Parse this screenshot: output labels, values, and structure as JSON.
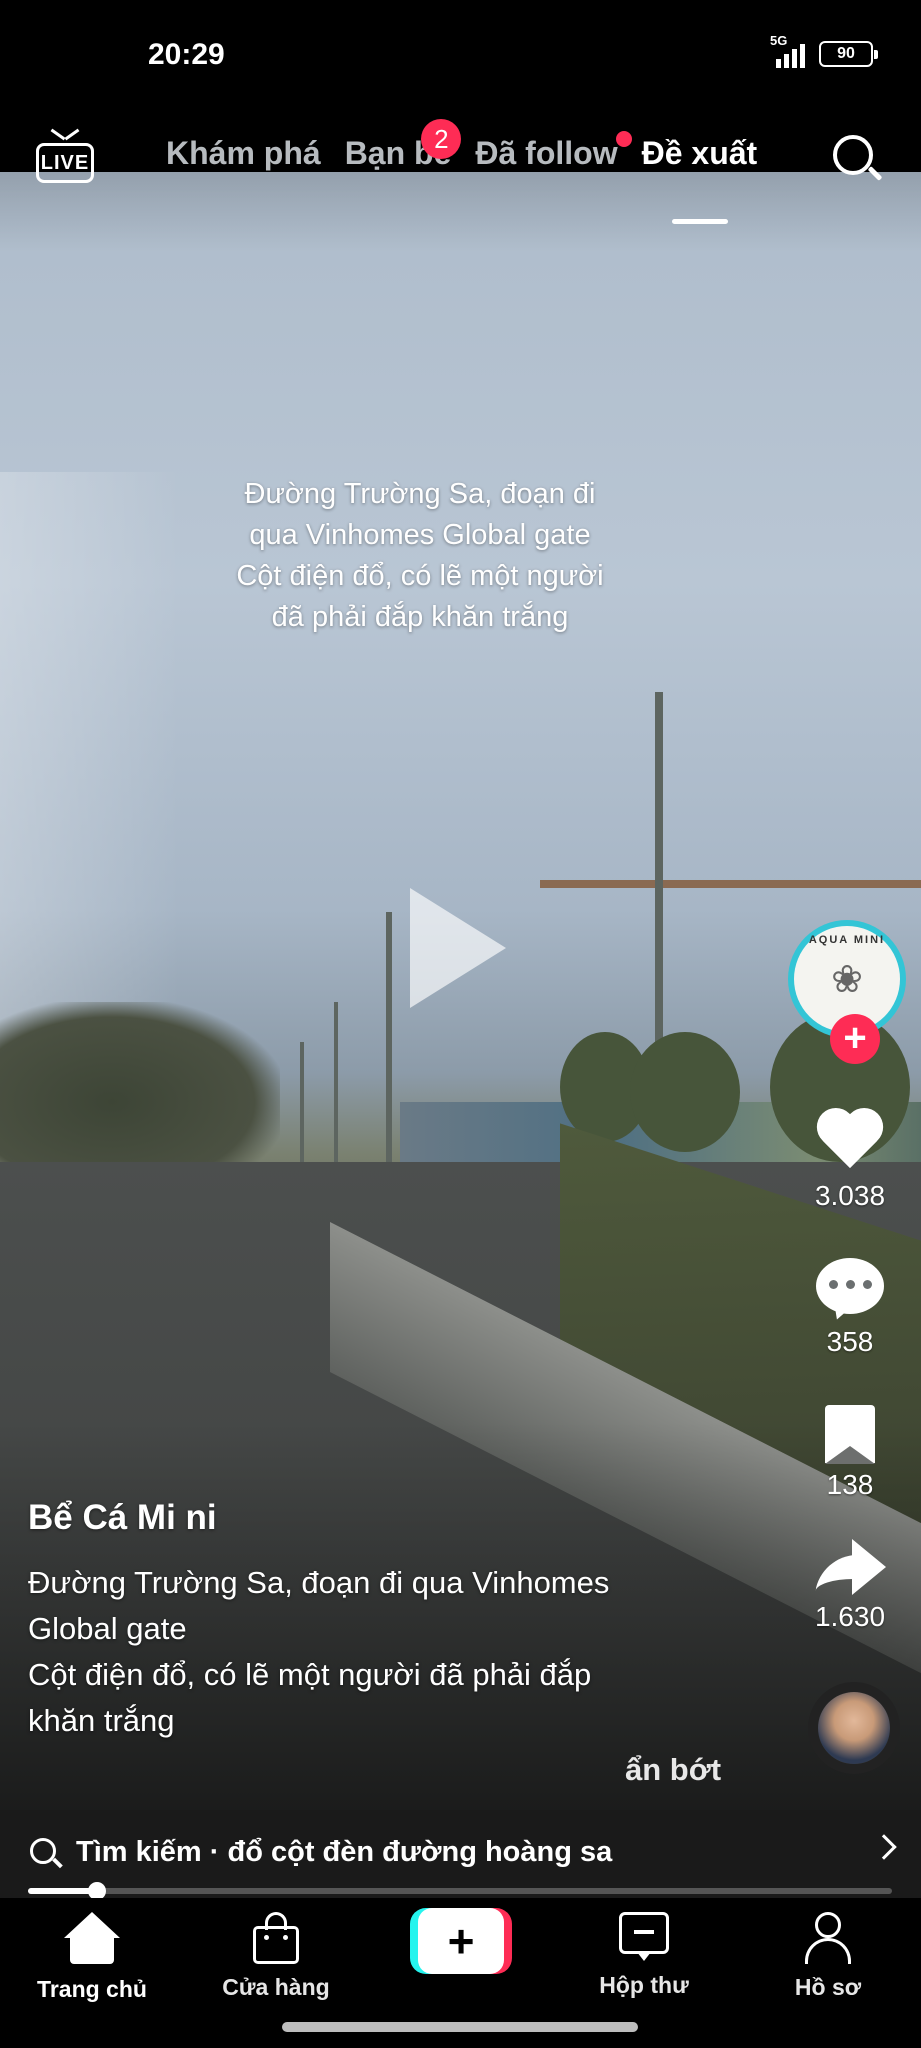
{
  "status_bar": {
    "time": "20:29",
    "network": "5G",
    "battery": "90"
  },
  "top_nav": {
    "live_label": "LIVE",
    "tabs": [
      {
        "label": "Khám phá"
      },
      {
        "label": "Bạn bè",
        "badge": "2"
      },
      {
        "label": "Đã follow"
      },
      {
        "label": "Đề xuất"
      }
    ]
  },
  "video": {
    "overlay_lines": [
      "Đường Trường Sa, đoạn đi",
      "qua Vinhomes Global gate",
      "Cột điện đổ, có lẽ một người",
      "đã phải đắp khăn trắng"
    ]
  },
  "actions": {
    "avatar_text": "AQUA MINI",
    "likes": "3.038",
    "comments": "358",
    "saves": "138",
    "shares": "1.630"
  },
  "caption": {
    "author": "Bể Cá Mi ni",
    "lines": [
      "Đường Trường Sa, đoạn đi qua Vinhomes",
      "Global gate",
      "Cột điện đổ, có lẽ một người đã phải đắp",
      "khăn trắng"
    ],
    "less": "ẩn bớt"
  },
  "search_bar": {
    "label": "Tìm kiếm · đổ cột đèn đường hoàng sa"
  },
  "progress": {
    "fraction": 0.08
  },
  "bottom_nav": {
    "home": "Trang chủ",
    "shop": "Cửa hàng",
    "create": "+",
    "inbox": "Hộp thư",
    "profile": "Hồ sơ"
  },
  "colors": {
    "accent_red": "#fe2c55",
    "accent_cyan": "#25f4ee",
    "avatar_ring": "#33c5d6"
  }
}
